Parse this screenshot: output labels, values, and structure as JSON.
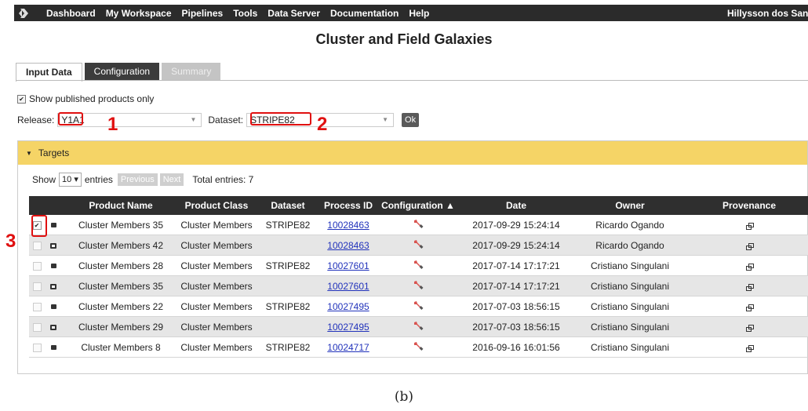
{
  "nav": {
    "items": [
      "Dashboard",
      "My Workspace",
      "Pipelines",
      "Tools",
      "Data Server",
      "Documentation",
      "Help"
    ],
    "user": "Hillysson dos Santos"
  },
  "page_title": "Cluster and Field Galaxies",
  "tabs": [
    "Input Data",
    "Configuration",
    "Summary"
  ],
  "show_published_label": "Show published products only",
  "release": {
    "label": "Release:",
    "value": "Y1A1"
  },
  "dataset": {
    "label": "Dataset:",
    "value": "STRIPE82"
  },
  "ok_label": "Ok",
  "annotations": [
    "1",
    "2",
    "3"
  ],
  "targets": {
    "title": "Targets",
    "show_label": "Show",
    "entries_count": "10",
    "entries_label": "entries",
    "previous_label": "Previous",
    "next_label": "Next",
    "total_label": "Total entries: 7",
    "columns": [
      "Product Name",
      "Product Class",
      "Dataset",
      "Process ID",
      "Configuration ▲",
      "Date",
      "Owner",
      "Provenance"
    ],
    "rows": [
      {
        "checked": true,
        "name": "Cluster Members 35",
        "class": "Cluster Members",
        "dataset": "STRIPE82",
        "process_id": "10028463",
        "date": "2017-09-29 15:24:14",
        "owner": "Ricardo Ogando"
      },
      {
        "checked": false,
        "name": "Cluster Members 42",
        "class": "Cluster Members",
        "dataset": "",
        "process_id": "10028463",
        "date": "2017-09-29 15:24:14",
        "owner": "Ricardo Ogando"
      },
      {
        "checked": false,
        "name": "Cluster Members 28",
        "class": "Cluster Members",
        "dataset": "STRIPE82",
        "process_id": "10027601",
        "date": "2017-07-14 17:17:21",
        "owner": "Cristiano Singulani"
      },
      {
        "checked": false,
        "name": "Cluster Members 35",
        "class": "Cluster Members",
        "dataset": "",
        "process_id": "10027601",
        "date": "2017-07-14 17:17:21",
        "owner": "Cristiano Singulani"
      },
      {
        "checked": false,
        "name": "Cluster Members 22",
        "class": "Cluster Members",
        "dataset": "STRIPE82",
        "process_id": "10027495",
        "date": "2017-07-03 18:56:15",
        "owner": "Cristiano Singulani"
      },
      {
        "checked": false,
        "name": "Cluster Members 29",
        "class": "Cluster Members",
        "dataset": "",
        "process_id": "10027495",
        "date": "2017-07-03 18:56:15",
        "owner": "Cristiano Singulani"
      },
      {
        "checked": false,
        "name": "Cluster Members 8",
        "class": "Cluster Members",
        "dataset": "STRIPE82",
        "process_id": "10024717",
        "date": "2016-09-16 16:01:56",
        "owner": "Cristiano Singulani"
      }
    ]
  },
  "caption": "(b)",
  "colors": {
    "navbar": "#2b2b2b",
    "panel_header": "#f5d466",
    "annotation": "#e01010",
    "link": "#2233bb"
  }
}
